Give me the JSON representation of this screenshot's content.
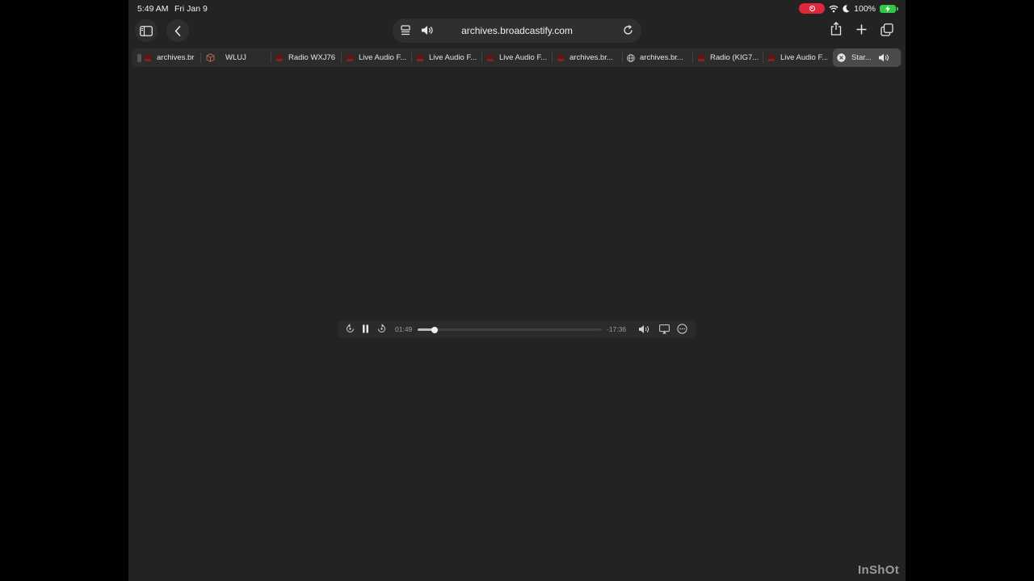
{
  "status_bar": {
    "time": "5:49 AM",
    "date": "Fri Jan 9",
    "battery": "100%"
  },
  "address_bar": {
    "url": "archives.broadcastify.com"
  },
  "tabs": [
    {
      "label": "archives.br",
      "favicon": "broadcastify-favicon"
    },
    {
      "label": "WLUJ",
      "favicon": "cube-icon"
    },
    {
      "label": "Radio WXJ76",
      "favicon": "broadcastify-favicon"
    },
    {
      "label": "Live Audio F...",
      "favicon": "broadcastify-favicon"
    },
    {
      "label": "Live Audio F...",
      "favicon": "broadcastify-favicon"
    },
    {
      "label": "Live Audio F...",
      "favicon": "broadcastify-favicon"
    },
    {
      "label": "archives.br...",
      "favicon": "broadcastify-favicon"
    },
    {
      "label": "archives.br...",
      "favicon": "globe-icon"
    },
    {
      "label": "Radio (KIG7...",
      "favicon": "broadcastify-favicon"
    },
    {
      "label": "Live Audio F...",
      "favicon": "broadcastify-favicon"
    },
    {
      "label": "Star...",
      "favicon": "close-icon",
      "active": true,
      "audio": true
    }
  ],
  "player": {
    "elapsed": "01:49",
    "remaining": "-17:36",
    "progress_fraction": 0.094
  },
  "watermark": "InShOt",
  "colors": {
    "background": "#232323",
    "record_indicator": "#e0283c",
    "battery": "#33c748"
  }
}
